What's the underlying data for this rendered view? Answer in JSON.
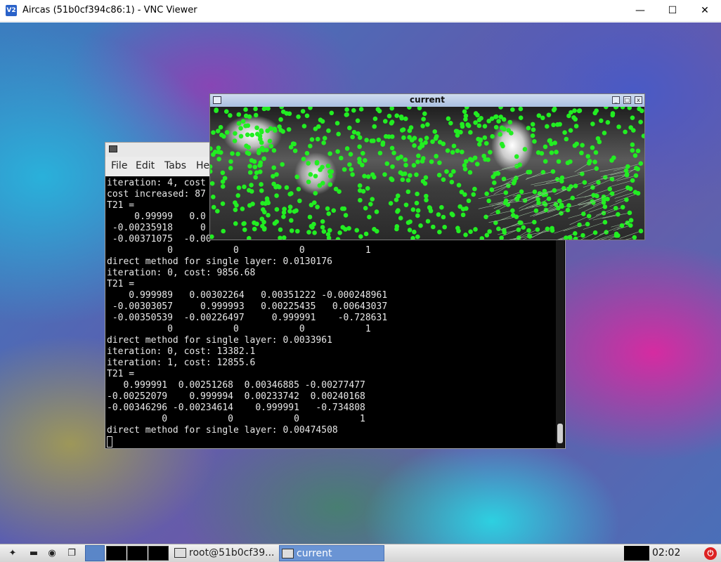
{
  "vnc": {
    "logo": "V2",
    "title": "Aircas (51b0cf394c86:1) - VNC Viewer",
    "minimize": "—",
    "maximize": "☐",
    "close": "✕"
  },
  "terminal": {
    "menu": [
      "File",
      "Edit",
      "Tabs",
      "He"
    ],
    "lines": [
      "iteration: 4, cost",
      "cost increased: 87",
      "T21 =",
      "     0.99999   0.0",
      " -0.00235918     0",
      " -0.00371075  -0.00",
      "           0           0           0           1",
      "direct method for single layer: 0.0130176",
      "iteration: 0, cost: 9856.68",
      "T21 =",
      "    0.999989   0.00302264   0.00351222 -0.000248961",
      " -0.00303057     0.999993   0.00225435   0.00643037",
      " -0.00350539  -0.00226497     0.999991    -0.728631",
      "           0           0           0           1",
      "direct method for single layer: 0.0033961",
      "iteration: 0, cost: 13382.1",
      "iteration: 1, cost: 12855.6",
      "T21 =",
      "   0.999991  0.00251268  0.00346885 -0.00277477",
      "-0.00252079    0.999994  0.00233742  0.00240168",
      "-0.00346296 -0.00234614    0.999991   -0.734808",
      "          0           0           0           1",
      "direct method for single layer: 0.00474508"
    ]
  },
  "current_window": {
    "title": "current",
    "buttons": [
      "_",
      "□",
      "x"
    ]
  },
  "taskbar": {
    "tasks": [
      {
        "label": "root@51b0cf39...",
        "active": false
      },
      {
        "label": "current",
        "active": true
      }
    ],
    "clock": "02:02",
    "power_glyph": "⏻",
    "icons": [
      "menu-icon",
      "show-desktop-icon",
      "file-manager-icon",
      "browser-icon",
      "window-switch-icon",
      "terminal-launcher-icon"
    ]
  }
}
